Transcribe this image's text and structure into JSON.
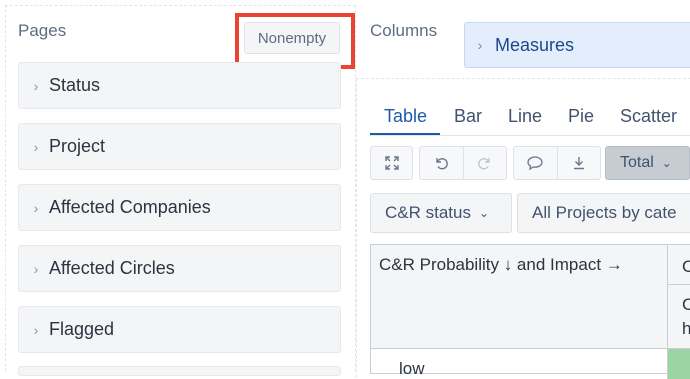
{
  "pages": {
    "title": "Pages",
    "nonempty_label": "Nonempty",
    "items": [
      {
        "label": "Status"
      },
      {
        "label": "Project"
      },
      {
        "label": "Affected Companies"
      },
      {
        "label": "Affected Circles"
      },
      {
        "label": "Flagged"
      }
    ]
  },
  "columns": {
    "title": "Columns",
    "measures_label": "Measures"
  },
  "tabs": [
    {
      "label": "Table",
      "active": true
    },
    {
      "label": "Bar"
    },
    {
      "label": "Line"
    },
    {
      "label": "Pie"
    },
    {
      "label": "Scatter"
    }
  ],
  "toolbar": {
    "total_label": "Total",
    "icons": [
      "fullscreen-icon",
      "undo-icon",
      "redo-icon",
      "comment-icon",
      "download-icon"
    ]
  },
  "selectors": {
    "status_label": "C&R status",
    "projects_label": "All Projects by cate"
  },
  "grid": {
    "header_text": "C&R Probability ↓ and Impact →",
    "col2_top": "C",
    "col2_bottom_line1": "C",
    "col2_bottom_line2": "h",
    "row_label": "low"
  },
  "colors": {
    "highlight": "#e8442f",
    "accent": "#1d5aa9",
    "measures_bg": "#e3edfb",
    "cell_green": "#9bd5a4"
  }
}
